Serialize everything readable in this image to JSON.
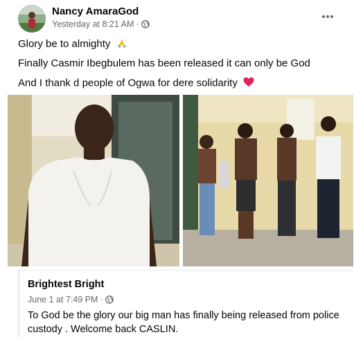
{
  "post": {
    "author": "Nancy AmaraGod",
    "timestamp": "Yesterday at 8:21 AM",
    "separator": "·",
    "privacy_icon": "globe-icon",
    "more_icon": "more-horizontal-icon",
    "lines": [
      "Glory be to almighty",
      "Finally Casmir Ibegbulem has been released it can only be God",
      "And I thank d people of Ogwa for dere solidarity"
    ],
    "line1_emoji": "praying-hands-icon",
    "line3_emoji": "red-heart-icon"
  },
  "photos": [
    {
      "name": "photo-man-white-shirt"
    },
    {
      "name": "photo-four-men-standing"
    }
  ],
  "shared_post": {
    "author": "Brightest Bright",
    "timestamp": "June 1 at 7:49 PM",
    "separator": "·",
    "privacy_icon": "globe-icon",
    "text": "To God be the glory our big man has finally being released from police custody . Welcome back CASLIN."
  },
  "colors": {
    "text_primary": "#050505",
    "text_secondary": "#65676b",
    "divider": "#e4e6eb",
    "heart": "#e0245e"
  }
}
